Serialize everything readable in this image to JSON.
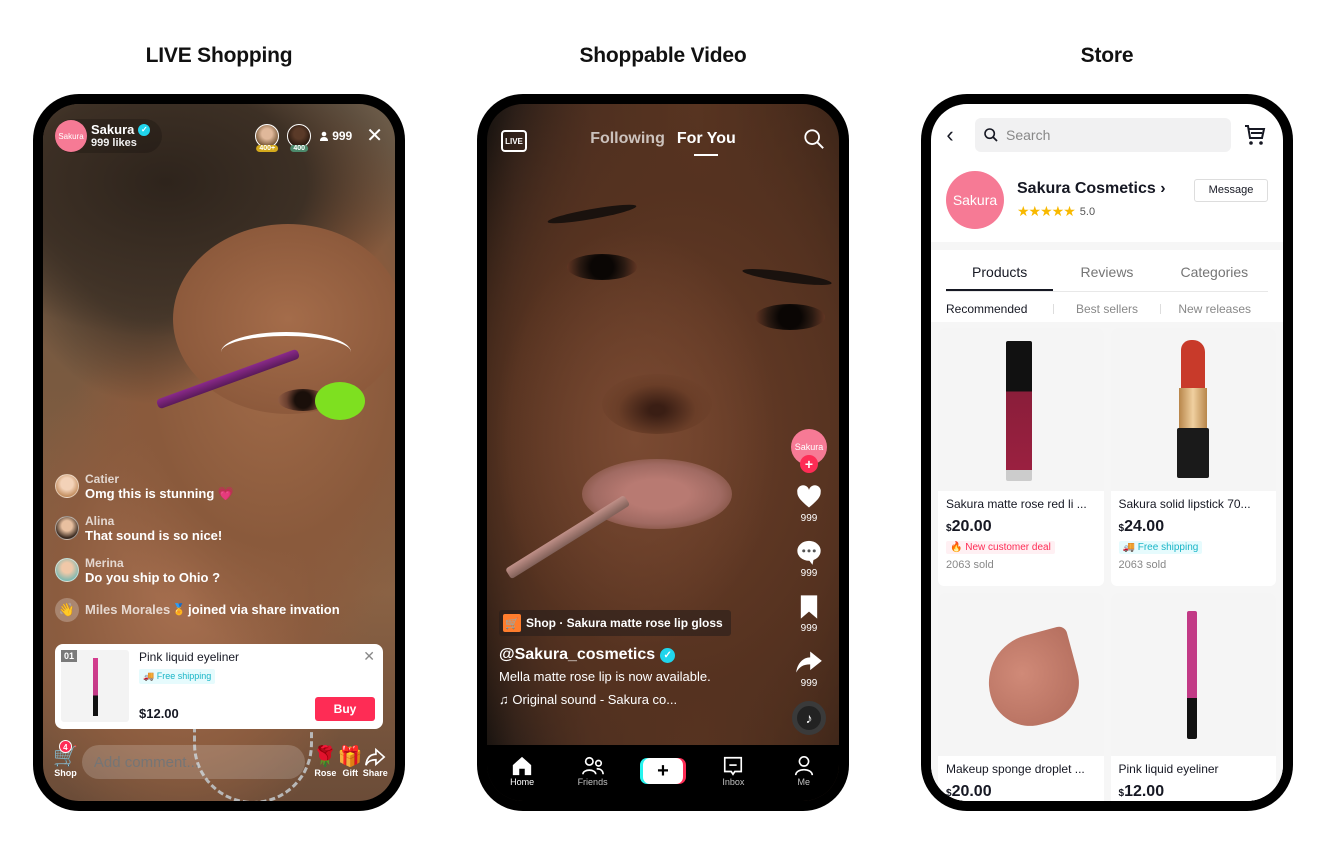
{
  "sections": {
    "live": "LIVE Shopping",
    "video": "Shoppable Video",
    "store": "Store"
  },
  "live": {
    "host": {
      "avatar_text": "Sakura",
      "name": "Sakura",
      "likes": "999 likes"
    },
    "top_viewers": [
      {
        "badge": "400+"
      },
      {
        "badge": "400"
      }
    ],
    "viewer_count": "999",
    "comments": [
      {
        "name": "Catier",
        "text": "Omg this is stunning 💗"
      },
      {
        "name": "Alina",
        "text": "That sound is so nice!"
      },
      {
        "name": "Merina",
        "text": "Do you ship to Ohio ?"
      }
    ],
    "joined": {
      "name": "Miles Morales",
      "medal": "🏅",
      "text": "joined via share invation"
    },
    "product": {
      "number": "01",
      "title": "Pink liquid eyeliner",
      "tag": "Free shipping",
      "price": "$12.00",
      "buy_label": "Buy",
      "close": "✕"
    },
    "bottom": {
      "shop_label": "Shop",
      "shop_badge": "4",
      "comment_placeholder": "Add comment...",
      "rose_label": "Rose",
      "gift_label": "Gift",
      "share_label": "Share"
    }
  },
  "video": {
    "live_icon_text": "LIVE",
    "tabs": [
      {
        "label": "Following"
      },
      {
        "label": "For You"
      }
    ],
    "creator_avatar": "Sakura",
    "actions": {
      "likes": "999",
      "comments": "999",
      "saves": "999",
      "shares": "999"
    },
    "shop_anchor": "Shop · Sakura matte rose lip gloss",
    "username": "@Sakura_cosmetics",
    "description": "Mella matte rose lip is now available.",
    "sound": "Original sound - Sakura co...",
    "nav": [
      {
        "label": "Home"
      },
      {
        "label": "Friends"
      },
      {
        "label": ""
      },
      {
        "label": "Inbox"
      },
      {
        "label": "Me"
      }
    ]
  },
  "store": {
    "search_placeholder": "Search",
    "logo_text": "Sakura",
    "name": "Sakura Cosmetics",
    "rating": "5.0",
    "rating_stars": 5,
    "message_label": "Message",
    "tabs": [
      {
        "label": "Products"
      },
      {
        "label": "Reviews"
      },
      {
        "label": "Categories"
      }
    ],
    "subtabs": [
      {
        "label": "Recommended"
      },
      {
        "label": "Best sellers"
      },
      {
        "label": "New releases"
      }
    ],
    "products": [
      {
        "title": "Sakura matte rose red li ...",
        "currency": "$",
        "price": "20.00",
        "tag": "New customer deal",
        "tag_type": "deal",
        "sold": "2063 sold"
      },
      {
        "title": "Sakura solid lipstick 70...",
        "currency": "$",
        "price": "24.00",
        "tag": "Free shipping",
        "tag_type": "ship",
        "sold": "2063 sold"
      },
      {
        "title": "Makeup sponge droplet ...",
        "currency": "$",
        "price": "20.00"
      },
      {
        "title": "Pink liquid eyeliner",
        "currency": "$",
        "price": "12.00"
      }
    ]
  },
  "colors": {
    "brand_pink": "#f67a95",
    "tiktok_red": "#fe2c55",
    "tiktok_cyan": "#25f4ee",
    "verified": "#20d5ec",
    "star": "#f8b900"
  }
}
